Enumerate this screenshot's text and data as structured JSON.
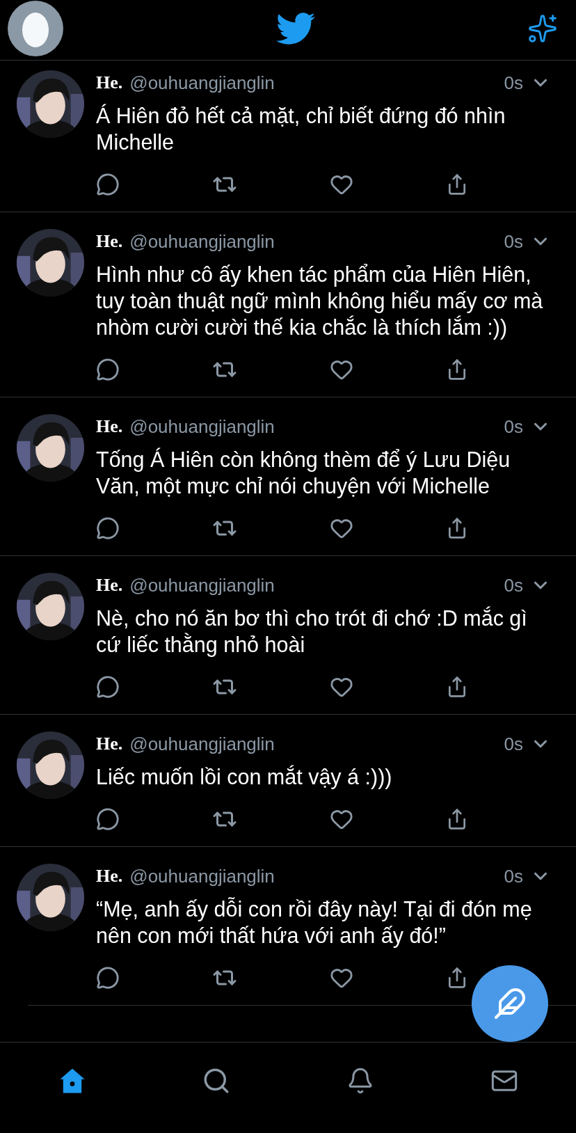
{
  "tweets": [
    {
      "name": "He.",
      "handle": "@ouhuangjianglin",
      "time": "0s",
      "text": "Á Hiên đỏ hết cả mặt, chỉ biết đứng đó nhìn Michelle"
    },
    {
      "name": "He.",
      "handle": "@ouhuangjianglin",
      "time": "0s",
      "text": "Hình như cô ấy khen tác phẩm của Hiên Hiên, tuy toàn thuật ngữ mình không hiểu mấy cơ mà nhòm cười cười thế kia chắc là thích lắm :))"
    },
    {
      "name": "He.",
      "handle": "@ouhuangjianglin",
      "time": "0s",
      "text": "Tống Á Hiên còn không thèm để ý Lưu Diệu Văn, một mực chỉ nói chuyện với Michelle"
    },
    {
      "name": "He.",
      "handle": "@ouhuangjianglin",
      "time": "0s",
      "text": "Nè, cho nó ăn bơ thì cho trót đi chớ :D mắc gì cứ liếc thằng nhỏ hoài"
    },
    {
      "name": "He.",
      "handle": "@ouhuangjianglin",
      "time": "0s",
      "text": "Liếc muốn lồi con mắt vậy á :)))"
    },
    {
      "name": "He.",
      "handle": "@ouhuangjianglin",
      "time": "0s",
      "text": "“Mẹ, anh ấy dỗi con rồi đây này! Tại đi đón mẹ nên con mới thất hứa với anh ấy đó!”"
    }
  ],
  "bottom_nav": [
    {
      "kind": "home",
      "selected": true
    },
    {
      "kind": "search",
      "selected": false
    },
    {
      "kind": "notifications",
      "selected": false
    },
    {
      "kind": "messages",
      "selected": false
    }
  ]
}
